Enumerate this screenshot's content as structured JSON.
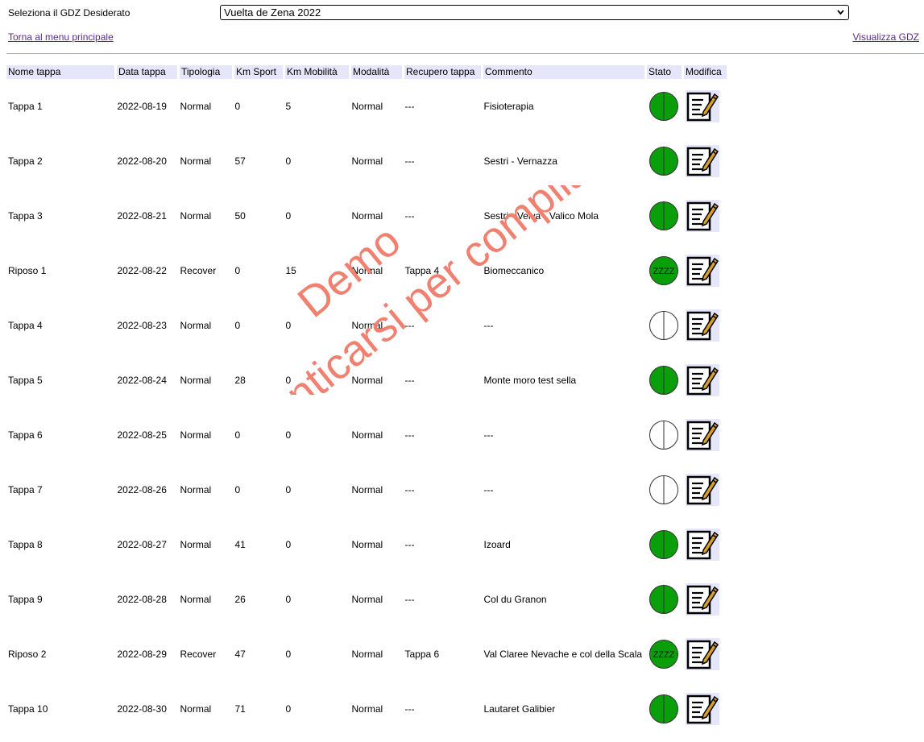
{
  "header": {
    "select_label": "Seleziona il GDZ Desiderato",
    "selected_gdz": "Vuelta de Zena 2022",
    "home_link": "Torna al menu principale",
    "view_link": "Visualizza GDZ"
  },
  "table": {
    "columns": [
      "Nome tappa",
      "Data tappa",
      "Tipologia",
      "Km Sport",
      "Km Mobilità",
      "Modalità",
      "Recupero tappa",
      "Commento",
      "Stato",
      "Modifica"
    ],
    "rows": [
      {
        "nome": "Tappa 1",
        "data": "2022-08-19",
        "tipologia": "Normal",
        "km_sport": "0",
        "km_mobilita": "5",
        "modalita": "Normal",
        "recupero": "---",
        "commento": "Fisioterapia",
        "stato": "done"
      },
      {
        "nome": "Tappa 2",
        "data": "2022-08-20",
        "tipologia": "Normal",
        "km_sport": "57",
        "km_mobilita": "0",
        "modalita": "Normal",
        "recupero": "---",
        "commento": "Sestri - Vernazza",
        "stato": "done"
      },
      {
        "nome": "Tappa 3",
        "data": "2022-08-21",
        "tipologia": "Normal",
        "km_sport": "50",
        "km_mobilita": "0",
        "modalita": "Normal",
        "recupero": "---",
        "commento": "Sestri - Velva - Valico Mola",
        "stato": "done"
      },
      {
        "nome": "Riposo 1",
        "data": "2022-08-22",
        "tipologia": "Recover",
        "km_sport": "0",
        "km_mobilita": "15",
        "modalita": "Normal",
        "recupero": "Tappa 4",
        "commento": "Biomeccanico",
        "stato": "rest"
      },
      {
        "nome": "Tappa 4",
        "data": "2022-08-23",
        "tipologia": "Normal",
        "km_sport": "0",
        "km_mobilita": "0",
        "modalita": "Normal",
        "recupero": "---",
        "commento": "---",
        "stato": "empty"
      },
      {
        "nome": "Tappa 5",
        "data": "2022-08-24",
        "tipologia": "Normal",
        "km_sport": "28",
        "km_mobilita": "0",
        "modalita": "Normal",
        "recupero": "---",
        "commento": "Monte moro test sella",
        "stato": "done"
      },
      {
        "nome": "Tappa 6",
        "data": "2022-08-25",
        "tipologia": "Normal",
        "km_sport": "0",
        "km_mobilita": "0",
        "modalita": "Normal",
        "recupero": "---",
        "commento": "---",
        "stato": "empty"
      },
      {
        "nome": "Tappa 7",
        "data": "2022-08-26",
        "tipologia": "Normal",
        "km_sport": "0",
        "km_mobilita": "0",
        "modalita": "Normal",
        "recupero": "---",
        "commento": "---",
        "stato": "empty"
      },
      {
        "nome": "Tappa 8",
        "data": "2022-08-27",
        "tipologia": "Normal",
        "km_sport": "41",
        "km_mobilita": "0",
        "modalita": "Normal",
        "recupero": "---",
        "commento": "Izoard",
        "stato": "done"
      },
      {
        "nome": "Tappa 9",
        "data": "2022-08-28",
        "tipologia": "Normal",
        "km_sport": "26",
        "km_mobilita": "0",
        "modalita": "Normal",
        "recupero": "---",
        "commento": "Col du Granon",
        "stato": "done"
      },
      {
        "nome": "Riposo 2",
        "data": "2022-08-29",
        "tipologia": "Recover",
        "km_sport": "47",
        "km_mobilita": "0",
        "modalita": "Normal",
        "recupero": "Tappa 6",
        "commento": "Val Claree Nevache e col della Scala",
        "stato": "rest"
      },
      {
        "nome": "Tappa 10",
        "data": "2022-08-30",
        "tipologia": "Normal",
        "km_sport": "71",
        "km_mobilita": "0",
        "modalita": "Normal",
        "recupero": "---",
        "commento": "Lautaret Galibier",
        "stato": "done"
      }
    ]
  },
  "status_icons": {
    "done": "green-split-circle-icon",
    "rest": "green-zzzz-circle-icon",
    "empty": "empty-split-circle-icon",
    "rest_text": "ZZZZ"
  },
  "colors": {
    "status_green": "#0a9e0a",
    "header_bg": "#e6e6fa",
    "link": "#5a2a86",
    "watermark": "#f08070"
  },
  "watermark": {
    "line1": "Demo",
    "line2": "Autenticarsi per compilare"
  }
}
